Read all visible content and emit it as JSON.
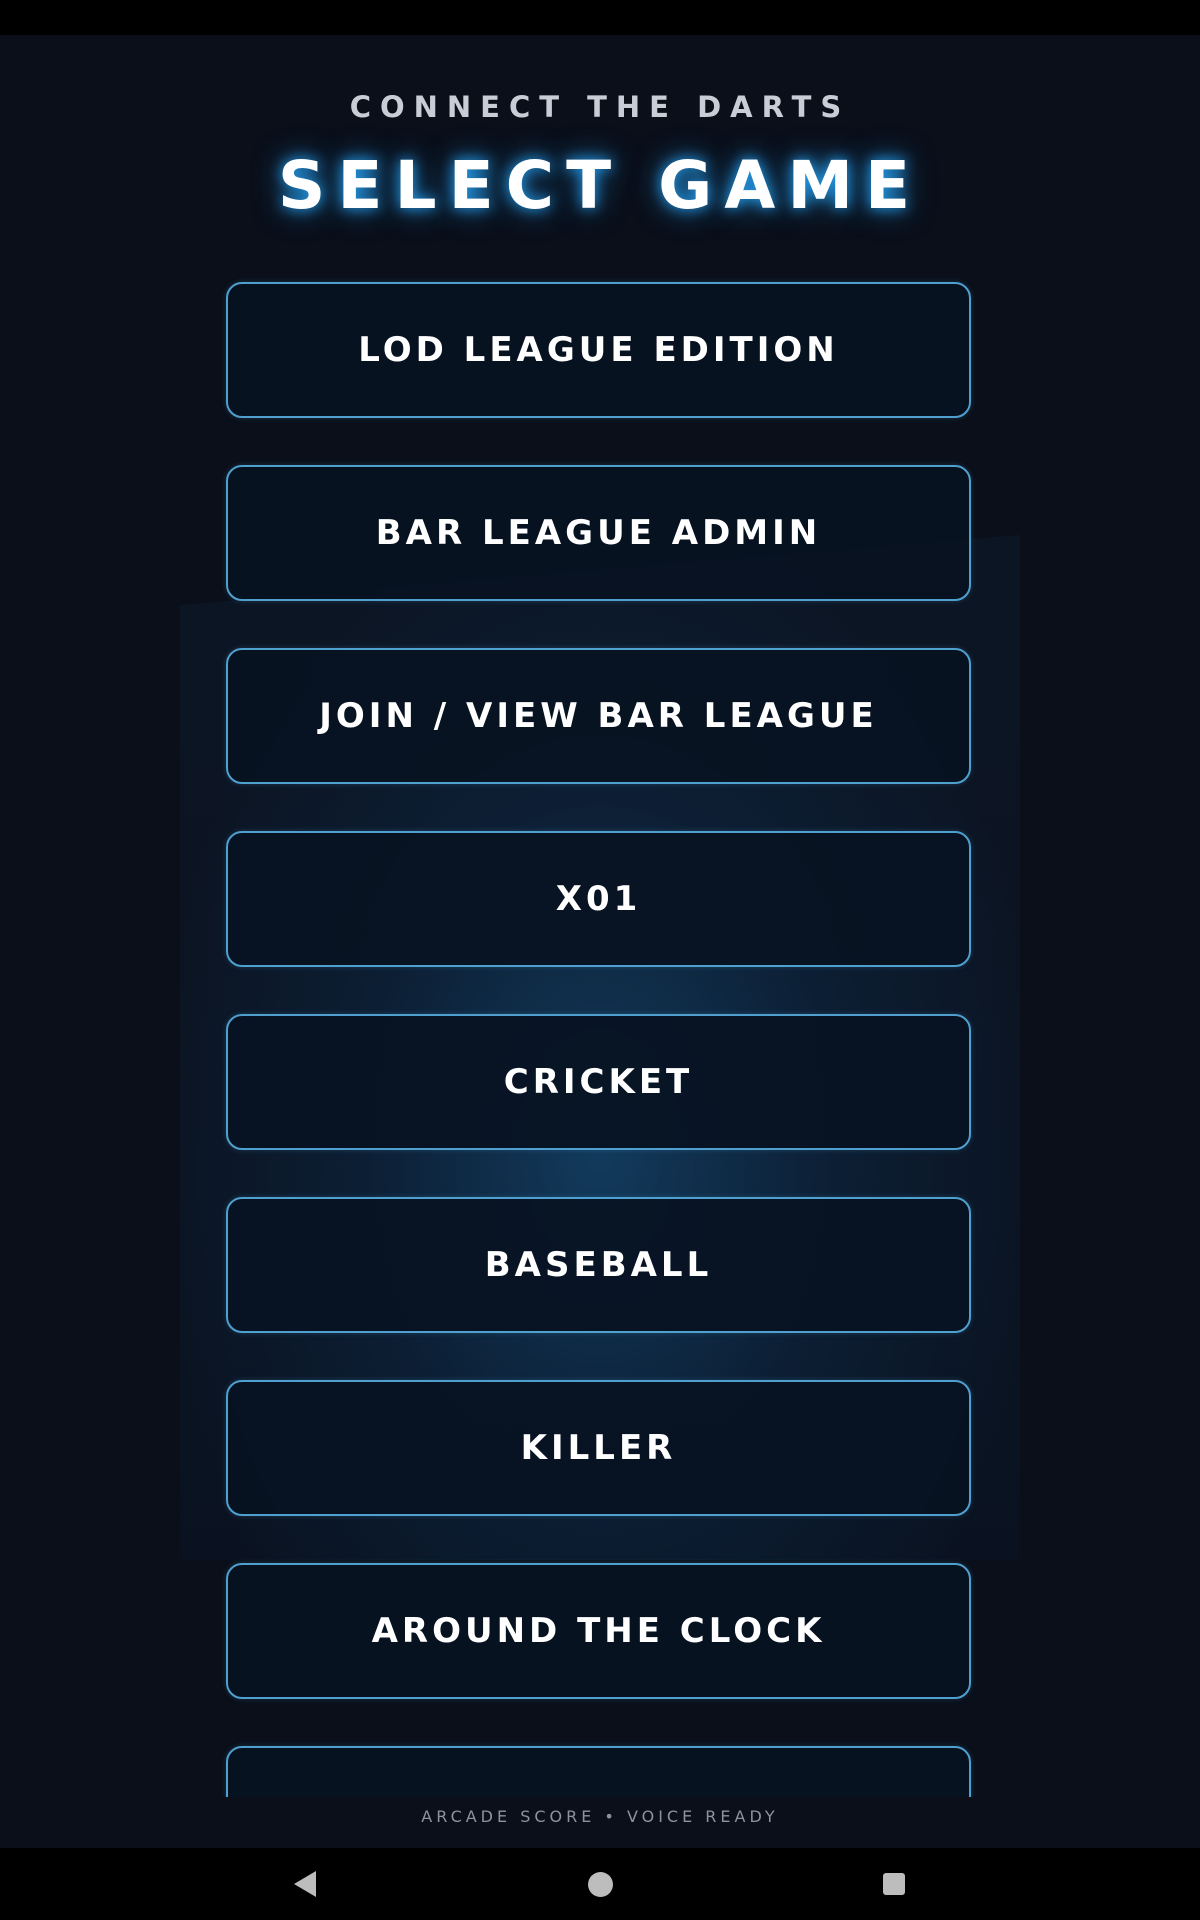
{
  "app": {
    "subtitle": "CONNECT THE DARTS",
    "title": "SELECT GAME",
    "footer": "ARCADE SCORE • VOICE READY"
  },
  "games": [
    "LOD LEAGUE EDITION",
    "BAR LEAGUE ADMIN",
    "JOIN / VIEW BAR LEAGUE",
    "X01",
    "CRICKET",
    "BASEBALL",
    "KILLER",
    "AROUND THE CLOCK",
    ""
  ],
  "colors": {
    "background": "#0a0f1a",
    "button_border": "#4f9fcf",
    "title_glow": "#28aaff",
    "text": "#ffffff"
  },
  "nav": {
    "back_icon": "back-triangle-icon",
    "home_icon": "home-circle-icon",
    "recents_icon": "recents-square-icon"
  }
}
